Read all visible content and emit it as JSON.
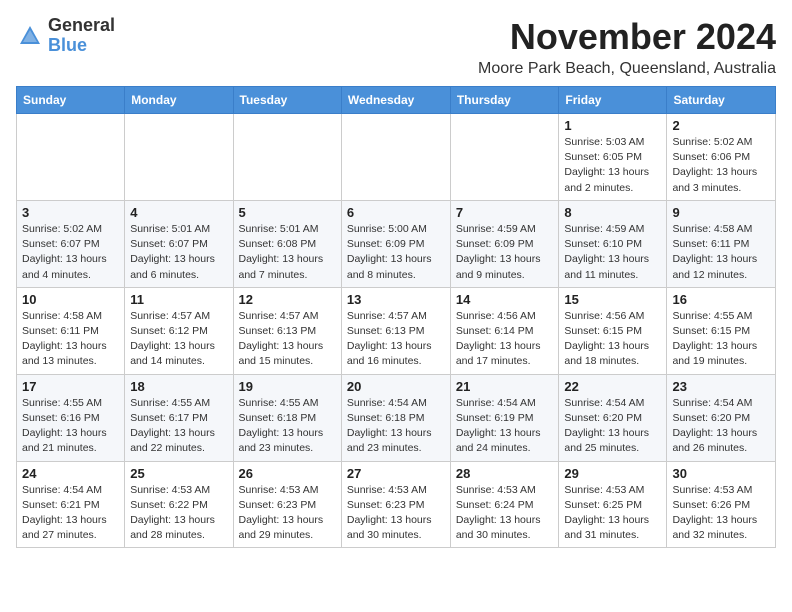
{
  "header": {
    "logo_general": "General",
    "logo_blue": "Blue",
    "month_title": "November 2024",
    "location": "Moore Park Beach, Queensland, Australia"
  },
  "calendar": {
    "weekdays": [
      "Sunday",
      "Monday",
      "Tuesday",
      "Wednesday",
      "Thursday",
      "Friday",
      "Saturday"
    ],
    "weeks": [
      [
        {
          "day": "",
          "sunrise": "",
          "sunset": "",
          "daylight": ""
        },
        {
          "day": "",
          "sunrise": "",
          "sunset": "",
          "daylight": ""
        },
        {
          "day": "",
          "sunrise": "",
          "sunset": "",
          "daylight": ""
        },
        {
          "day": "",
          "sunrise": "",
          "sunset": "",
          "daylight": ""
        },
        {
          "day": "",
          "sunrise": "",
          "sunset": "",
          "daylight": ""
        },
        {
          "day": "1",
          "sunrise": "Sunrise: 5:03 AM",
          "sunset": "Sunset: 6:05 PM",
          "daylight": "Daylight: 13 hours and 2 minutes."
        },
        {
          "day": "2",
          "sunrise": "Sunrise: 5:02 AM",
          "sunset": "Sunset: 6:06 PM",
          "daylight": "Daylight: 13 hours and 3 minutes."
        }
      ],
      [
        {
          "day": "3",
          "sunrise": "Sunrise: 5:02 AM",
          "sunset": "Sunset: 6:07 PM",
          "daylight": "Daylight: 13 hours and 4 minutes."
        },
        {
          "day": "4",
          "sunrise": "Sunrise: 5:01 AM",
          "sunset": "Sunset: 6:07 PM",
          "daylight": "Daylight: 13 hours and 6 minutes."
        },
        {
          "day": "5",
          "sunrise": "Sunrise: 5:01 AM",
          "sunset": "Sunset: 6:08 PM",
          "daylight": "Daylight: 13 hours and 7 minutes."
        },
        {
          "day": "6",
          "sunrise": "Sunrise: 5:00 AM",
          "sunset": "Sunset: 6:09 PM",
          "daylight": "Daylight: 13 hours and 8 minutes."
        },
        {
          "day": "7",
          "sunrise": "Sunrise: 4:59 AM",
          "sunset": "Sunset: 6:09 PM",
          "daylight": "Daylight: 13 hours and 9 minutes."
        },
        {
          "day": "8",
          "sunrise": "Sunrise: 4:59 AM",
          "sunset": "Sunset: 6:10 PM",
          "daylight": "Daylight: 13 hours and 11 minutes."
        },
        {
          "day": "9",
          "sunrise": "Sunrise: 4:58 AM",
          "sunset": "Sunset: 6:11 PM",
          "daylight": "Daylight: 13 hours and 12 minutes."
        }
      ],
      [
        {
          "day": "10",
          "sunrise": "Sunrise: 4:58 AM",
          "sunset": "Sunset: 6:11 PM",
          "daylight": "Daylight: 13 hours and 13 minutes."
        },
        {
          "day": "11",
          "sunrise": "Sunrise: 4:57 AM",
          "sunset": "Sunset: 6:12 PM",
          "daylight": "Daylight: 13 hours and 14 minutes."
        },
        {
          "day": "12",
          "sunrise": "Sunrise: 4:57 AM",
          "sunset": "Sunset: 6:13 PM",
          "daylight": "Daylight: 13 hours and 15 minutes."
        },
        {
          "day": "13",
          "sunrise": "Sunrise: 4:57 AM",
          "sunset": "Sunset: 6:13 PM",
          "daylight": "Daylight: 13 hours and 16 minutes."
        },
        {
          "day": "14",
          "sunrise": "Sunrise: 4:56 AM",
          "sunset": "Sunset: 6:14 PM",
          "daylight": "Daylight: 13 hours and 17 minutes."
        },
        {
          "day": "15",
          "sunrise": "Sunrise: 4:56 AM",
          "sunset": "Sunset: 6:15 PM",
          "daylight": "Daylight: 13 hours and 18 minutes."
        },
        {
          "day": "16",
          "sunrise": "Sunrise: 4:55 AM",
          "sunset": "Sunset: 6:15 PM",
          "daylight": "Daylight: 13 hours and 19 minutes."
        }
      ],
      [
        {
          "day": "17",
          "sunrise": "Sunrise: 4:55 AM",
          "sunset": "Sunset: 6:16 PM",
          "daylight": "Daylight: 13 hours and 21 minutes."
        },
        {
          "day": "18",
          "sunrise": "Sunrise: 4:55 AM",
          "sunset": "Sunset: 6:17 PM",
          "daylight": "Daylight: 13 hours and 22 minutes."
        },
        {
          "day": "19",
          "sunrise": "Sunrise: 4:55 AM",
          "sunset": "Sunset: 6:18 PM",
          "daylight": "Daylight: 13 hours and 23 minutes."
        },
        {
          "day": "20",
          "sunrise": "Sunrise: 4:54 AM",
          "sunset": "Sunset: 6:18 PM",
          "daylight": "Daylight: 13 hours and 23 minutes."
        },
        {
          "day": "21",
          "sunrise": "Sunrise: 4:54 AM",
          "sunset": "Sunset: 6:19 PM",
          "daylight": "Daylight: 13 hours and 24 minutes."
        },
        {
          "day": "22",
          "sunrise": "Sunrise: 4:54 AM",
          "sunset": "Sunset: 6:20 PM",
          "daylight": "Daylight: 13 hours and 25 minutes."
        },
        {
          "day": "23",
          "sunrise": "Sunrise: 4:54 AM",
          "sunset": "Sunset: 6:20 PM",
          "daylight": "Daylight: 13 hours and 26 minutes."
        }
      ],
      [
        {
          "day": "24",
          "sunrise": "Sunrise: 4:54 AM",
          "sunset": "Sunset: 6:21 PM",
          "daylight": "Daylight: 13 hours and 27 minutes."
        },
        {
          "day": "25",
          "sunrise": "Sunrise: 4:53 AM",
          "sunset": "Sunset: 6:22 PM",
          "daylight": "Daylight: 13 hours and 28 minutes."
        },
        {
          "day": "26",
          "sunrise": "Sunrise: 4:53 AM",
          "sunset": "Sunset: 6:23 PM",
          "daylight": "Daylight: 13 hours and 29 minutes."
        },
        {
          "day": "27",
          "sunrise": "Sunrise: 4:53 AM",
          "sunset": "Sunset: 6:23 PM",
          "daylight": "Daylight: 13 hours and 30 minutes."
        },
        {
          "day": "28",
          "sunrise": "Sunrise: 4:53 AM",
          "sunset": "Sunset: 6:24 PM",
          "daylight": "Daylight: 13 hours and 30 minutes."
        },
        {
          "day": "29",
          "sunrise": "Sunrise: 4:53 AM",
          "sunset": "Sunset: 6:25 PM",
          "daylight": "Daylight: 13 hours and 31 minutes."
        },
        {
          "day": "30",
          "sunrise": "Sunrise: 4:53 AM",
          "sunset": "Sunset: 6:26 PM",
          "daylight": "Daylight: 13 hours and 32 minutes."
        }
      ]
    ]
  }
}
